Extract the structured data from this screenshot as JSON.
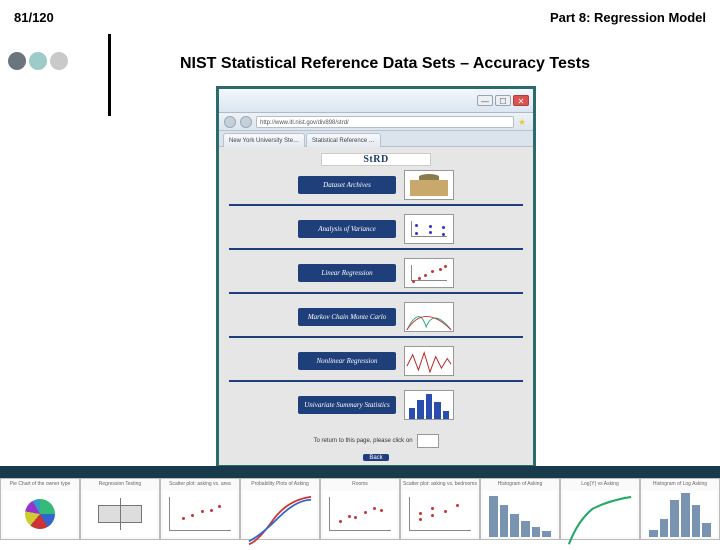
{
  "header": {
    "page_number": "81/120",
    "part_title": "Part 8: Regression Model"
  },
  "slide_title": "NIST Statistical Reference Data Sets – Accuracy Tests",
  "browser": {
    "window_buttons": {
      "min": "—",
      "max": "☐",
      "close": "✕"
    },
    "address": "http://www.itl.nist.gov/div898/strd/",
    "tabs": [
      {
        "label": "New York University Ste…"
      },
      {
        "label": "Statistical Reference …"
      }
    ]
  },
  "page": {
    "logo": "StRD",
    "sections": [
      {
        "label": "Dataset Archives",
        "thumb": "building"
      },
      {
        "label": "Analysis of Variance",
        "thumb": "anova"
      },
      {
        "label": "Linear Regression",
        "thumb": "linreg"
      },
      {
        "label": "Markov Chain Monte Carlo",
        "thumb": "mcmc"
      },
      {
        "label": "Nonlinear Regression",
        "thumb": "nonlin"
      },
      {
        "label": "Univariate Summary Statistics",
        "thumb": "bars"
      }
    ],
    "return_text": "To return to this page, please click on",
    "back_label": "Back"
  },
  "thumbnails": [
    {
      "caption": "Pie Chart of the owner type",
      "kind": "pie"
    },
    {
      "caption": "Regression Testing",
      "kind": "box"
    },
    {
      "caption": "Scatter plot: asking vs. area",
      "kind": "scatter"
    },
    {
      "caption": "Probability Plots of Asking",
      "kind": "prob"
    },
    {
      "caption": "Rooms",
      "kind": "scatter2"
    },
    {
      "caption": "Scatter plot: asking vs. bedrooms",
      "kind": "scatter3"
    },
    {
      "caption": "Histogram of Asking",
      "kind": "hist"
    },
    {
      "caption": "Log(Y) vs Asking",
      "kind": "logcurve"
    },
    {
      "caption": "Histogram of Log Asking",
      "kind": "hist2"
    }
  ],
  "colors": {
    "accent": "#2b6c6a",
    "navy": "#1f3f7a",
    "band": "#183a4a"
  }
}
